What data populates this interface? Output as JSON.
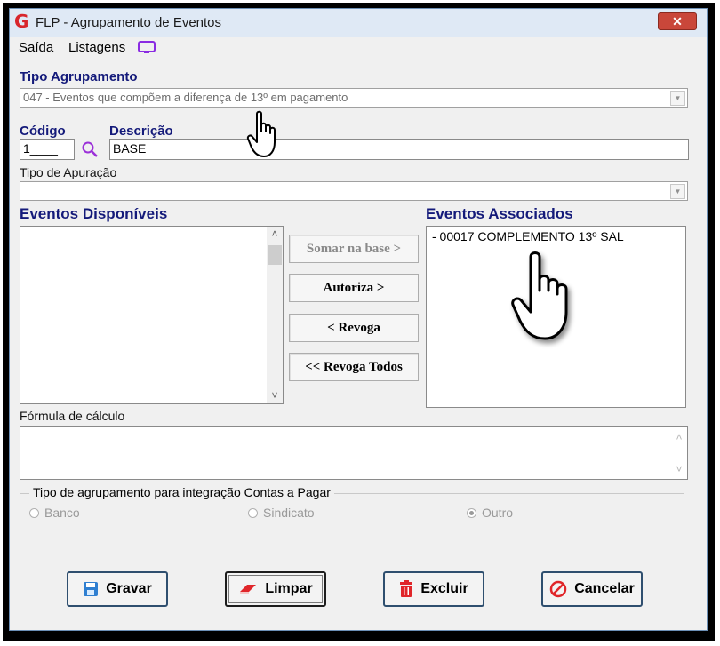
{
  "window": {
    "title": "FLP - Agrupamento de Eventos",
    "close_label": "✕",
    "logo_letter": "G"
  },
  "menu": {
    "saida": "Saída",
    "listagens": "Listagens"
  },
  "tipo_agrupamento": {
    "label": "Tipo Agrupamento",
    "value": "047 - Eventos que compõem a diferença de 13º em pagamento"
  },
  "codigo": {
    "label": "Código",
    "value": "1____"
  },
  "descricao": {
    "label": "Descrição",
    "value": "BASE"
  },
  "tipo_apuracao": {
    "label": "Tipo de Apuração",
    "value": ""
  },
  "disponiveis": {
    "label": "Eventos Disponíveis",
    "items": []
  },
  "associados": {
    "label": "Eventos Associados",
    "items": [
      "- 00017 COMPLEMENTO 13º SAL"
    ]
  },
  "mid_buttons": {
    "somar": "Somar  na base >",
    "autoriza": "Autoriza >",
    "revoga": "< Revoga",
    "revoga_todos": "<< Revoga Todos"
  },
  "formula": {
    "label": "Fórmula de cálculo",
    "value": ""
  },
  "integracao": {
    "legend": "Tipo de agrupamento para integração Contas a Pagar",
    "options": [
      "Banco",
      "Sindicato",
      "Outro"
    ],
    "selected": "Outro"
  },
  "footer": {
    "gravar": "Gravar",
    "limpar": "Limpar",
    "excluir": "Excluir",
    "cancelar": "Cancelar"
  },
  "colors": {
    "label_blue": "#141a7a",
    "logo_red": "#d8262c",
    "close_red": "#c9473a"
  }
}
